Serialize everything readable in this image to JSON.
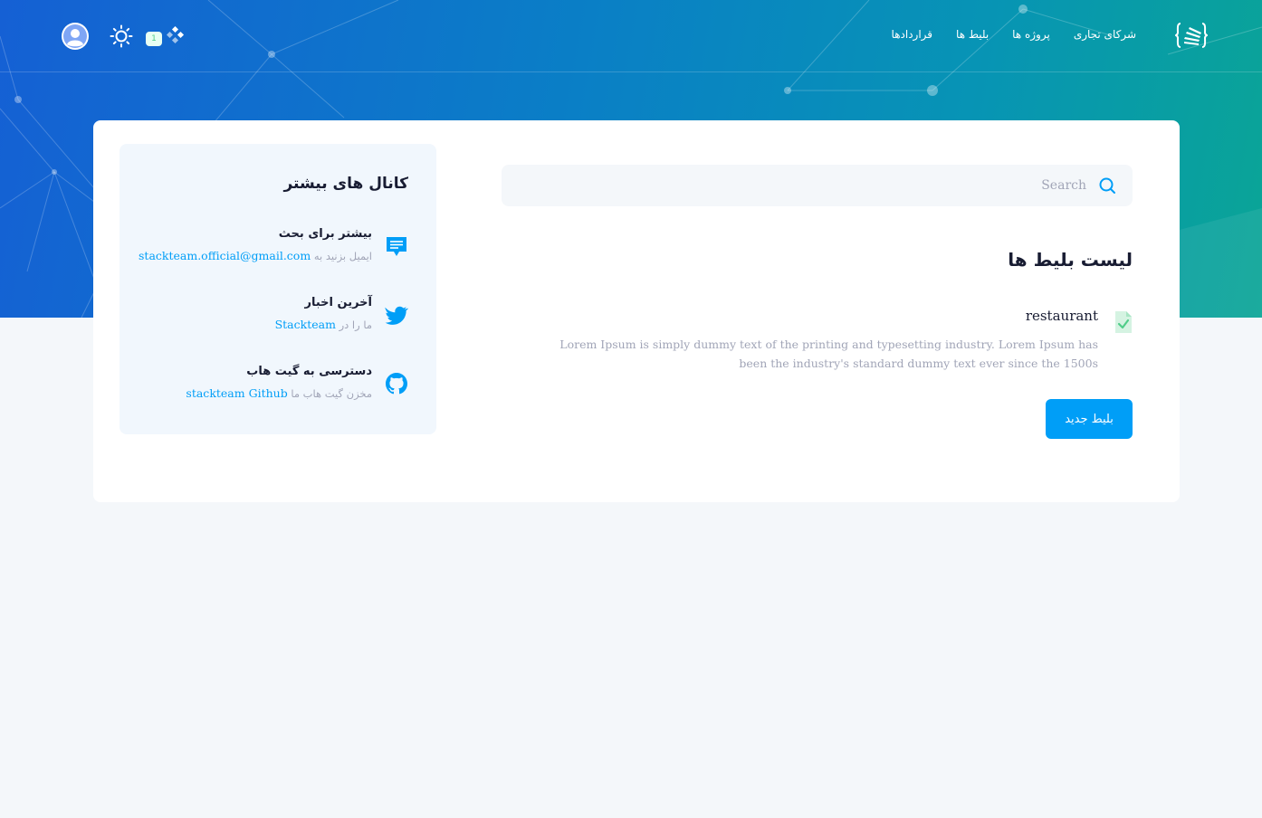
{
  "header": {
    "nav": [
      {
        "label": "شرکای تجاری"
      },
      {
        "label": "پروژه ها"
      },
      {
        "label": "بلیط ها"
      },
      {
        "label": "قراردادها"
      }
    ],
    "notification_count": "1"
  },
  "search": {
    "placeholder": "Search"
  },
  "tickets": {
    "title": "لیست بلیط ها",
    "items": [
      {
        "name": "restaurant",
        "description": "Lorem Ipsum is simply dummy text of the printing and typesetting industry. Lorem Ipsum has been the industry's standard dummy text ever since the 1500s",
        "icon": "file-check-icon"
      }
    ],
    "new_button": "بلیط جدید"
  },
  "channels": {
    "title": "کانال های بیشتر",
    "items": [
      {
        "icon": "message-icon",
        "title": "بیشتر برای بحث",
        "prefix": "ایمیل بزنید به",
        "link": "stackteam.official@gmail.com"
      },
      {
        "icon": "twitter-icon",
        "title": "آخرین اخبار",
        "prefix": "ما را در",
        "link": "Stackteam"
      },
      {
        "icon": "github-icon",
        "title": "دسترسی به گیت هاب",
        "prefix": "مخزن گیت هاب ما",
        "link": "stackteam Github"
      }
    ]
  },
  "colors": {
    "primary": "#009ef7",
    "success": "#50cd89",
    "hero_start": "#1560d4",
    "hero_end": "#0aa596",
    "page_bg": "#f4f7fa"
  }
}
